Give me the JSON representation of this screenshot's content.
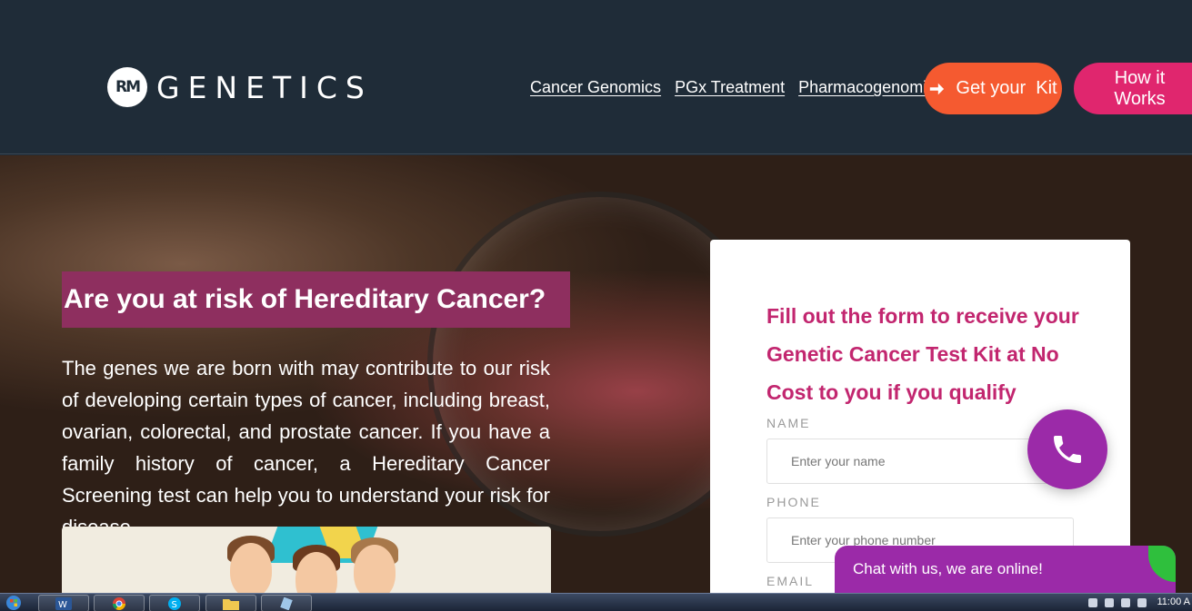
{
  "header": {
    "logo_badge": "RM",
    "logo_word": "GENETICS",
    "nav": [
      "Cancer Genomics",
      "PGx Treatment",
      "Pharmacogenomics"
    ],
    "get_kit_label": "Get your  Kit",
    "how_it_works_label": "How it Works"
  },
  "hero": {
    "title": "Are you at risk of Hereditary Cancer?",
    "text": "The genes we are born with may contribute to our risk of developing certain types of cancer, including breast, ovarian, colorectal, and prostate cancer. If you have a family history of cancer, a Hereditary Cancer Screening test can help you to understand your risk for disease."
  },
  "form": {
    "heading": "Fill out the form to receive your Genetic Cancer Test Kit at No Cost to you if you qualify",
    "name_label": "NAME",
    "name_placeholder": "Enter your name",
    "phone_label": "PHONE",
    "phone_placeholder": "Enter your phone number",
    "email_label": "EMAIL"
  },
  "chat": {
    "label": "Chat with us, we are online!"
  },
  "taskbar": {
    "time": "11:00 A"
  },
  "colors": {
    "header_bg": "#1f2c38",
    "orange": "#f55a30",
    "pink": "#e0266e",
    "magenta": "#c2266f",
    "purple": "#9b2aa8",
    "title_bg": "#8e2f5f"
  }
}
